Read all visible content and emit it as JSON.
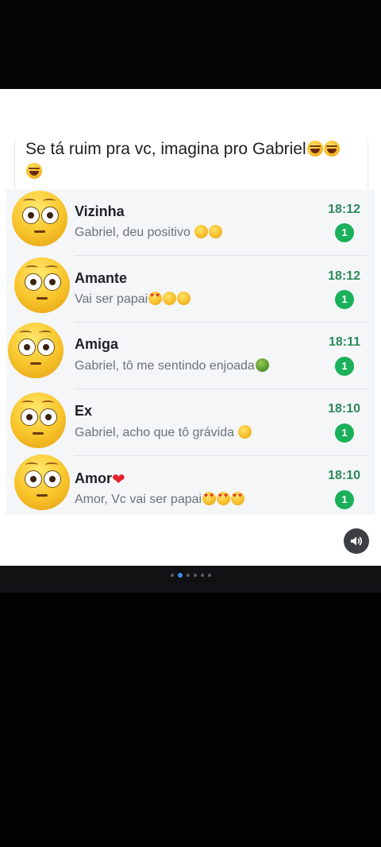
{
  "post": {
    "caption_text": "Se tá ruim pra vc, imagina pro Gabriel"
  },
  "chats": [
    {
      "name": "Vizinha",
      "preview": "Gabriel, deu positivo ",
      "time": "18:12",
      "unread": "1"
    },
    {
      "name": "Amante",
      "preview": "Vai ser papai",
      "time": "18:12",
      "unread": "1"
    },
    {
      "name": "Amiga",
      "preview": "Gabriel, tô me sentindo enjoada",
      "time": "18:11",
      "unread": "1"
    },
    {
      "name": "Ex",
      "preview": "Gabriel, acho que tô grávida ",
      "time": "18:10",
      "unread": "1"
    },
    {
      "name": "Amor",
      "preview": "Amor, Vc vai ser papai",
      "time": "18:10",
      "unread": "1"
    }
  ],
  "carousel": {
    "count": 6,
    "active_index": 1
  },
  "icons": {
    "sound": "volume-icon",
    "avatar": "flushed-face-icon"
  },
  "colors": {
    "time": "#2e8a5a",
    "badge": "#1bb05a",
    "active_dot": "#3a8ee8"
  }
}
